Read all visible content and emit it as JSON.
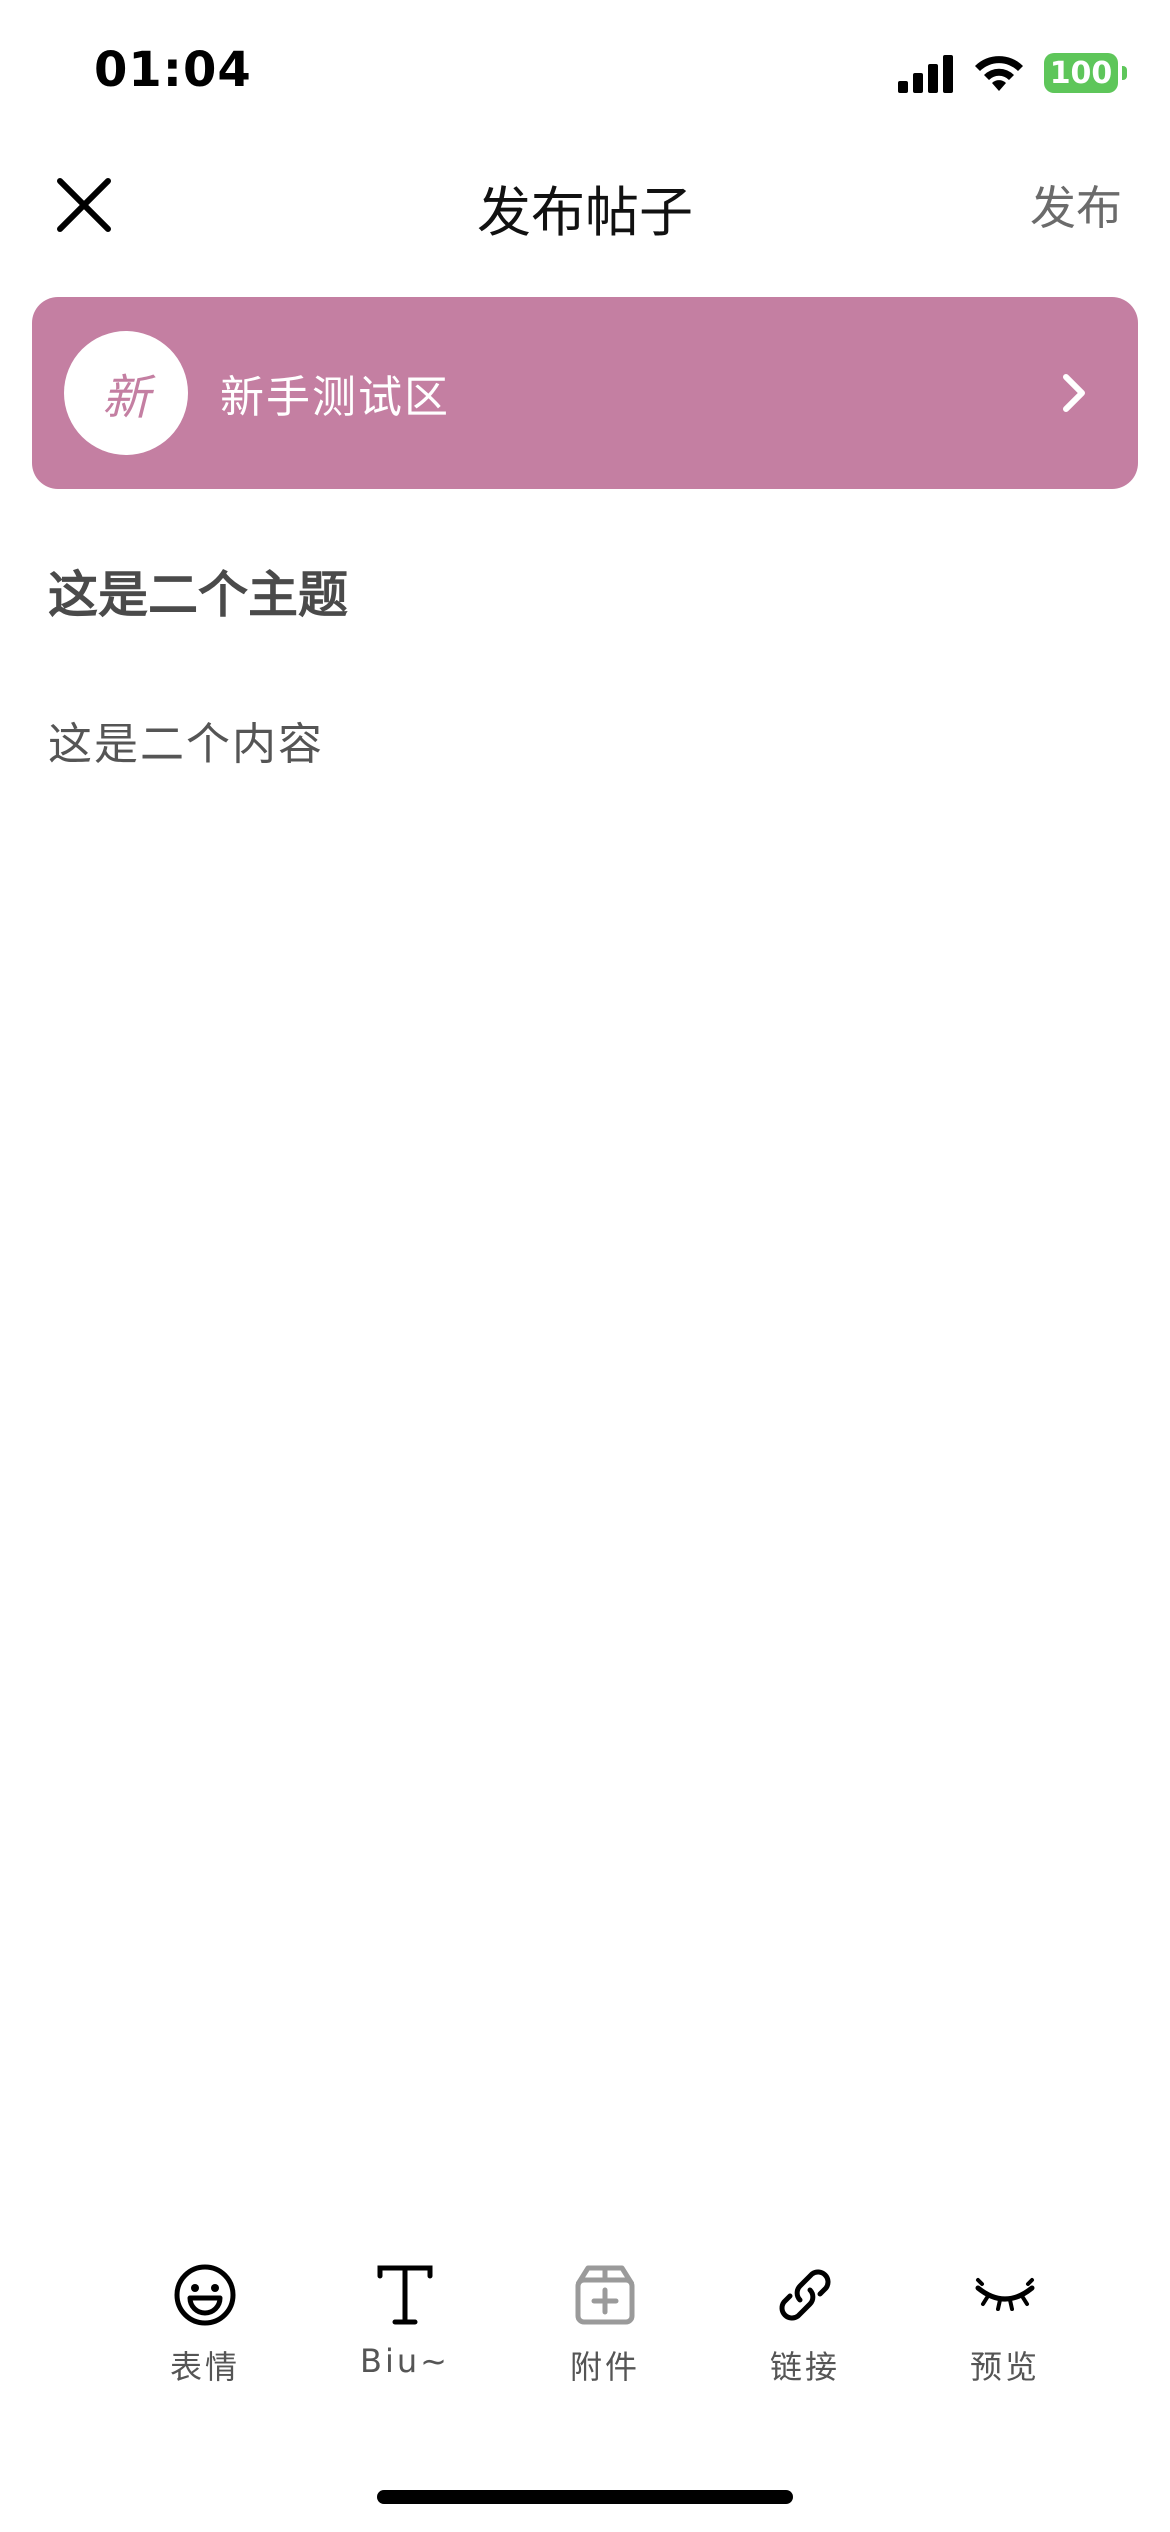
{
  "status_bar": {
    "time": "01:04",
    "battery": "100"
  },
  "nav": {
    "title": "发布帖子",
    "publish_label": "发布"
  },
  "forum": {
    "avatar_char": "新",
    "name": "新手测试区",
    "color": "#c47fa2"
  },
  "post": {
    "subject": "这是二个主题",
    "body": "这是二个内容"
  },
  "toolbar": {
    "items": [
      {
        "label": "表情",
        "icon": "smile-icon"
      },
      {
        "label": "Biu~",
        "icon": "text-format-icon"
      },
      {
        "label": "附件",
        "icon": "attachment-box-icon"
      },
      {
        "label": "链接",
        "icon": "link-icon"
      },
      {
        "label": "预览",
        "icon": "eye-closed-icon"
      }
    ]
  }
}
